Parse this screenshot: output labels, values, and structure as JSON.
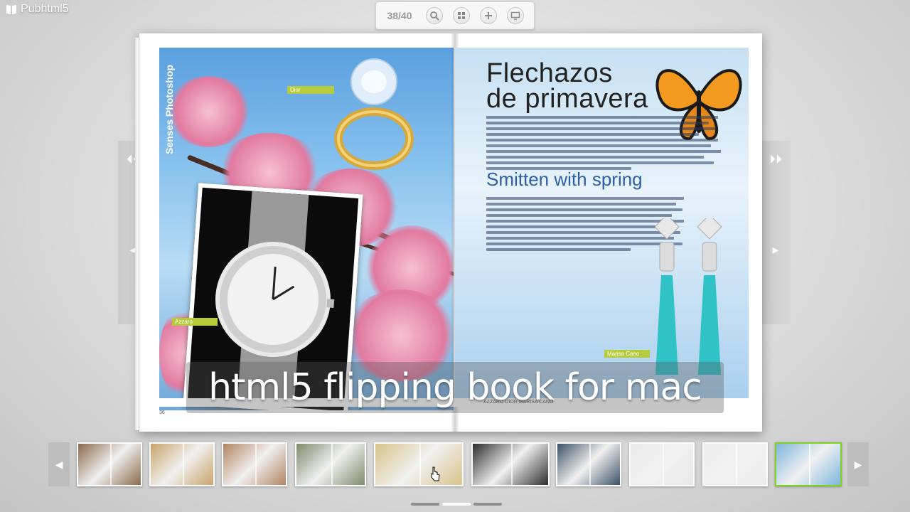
{
  "app": {
    "name": "Pubhtml5"
  },
  "toolbar": {
    "page_counter": "38/40",
    "buttons": [
      {
        "name": "search-icon",
        "label": "Search"
      },
      {
        "name": "grid-icon",
        "label": "Thumbnails"
      },
      {
        "name": "zoom-in-icon",
        "label": "Zoom in"
      },
      {
        "name": "fullscreen-icon",
        "label": "Fullscreen"
      }
    ]
  },
  "navigation": {
    "first_page_icon": "double-chevron-left-icon",
    "prev_page_icon": "chevron-left-icon",
    "last_page_icon": "double-chevron-right-icon",
    "next_page_icon": "chevron-right-icon"
  },
  "book": {
    "left_page": {
      "section_label": "Senses Photoshop",
      "tags": [
        "Dior",
        "Azzaro"
      ],
      "page_number": "36"
    },
    "right_page": {
      "title_line1": "Flechazos",
      "title_line2": "de primavera",
      "subtitle": "Smitten with spring",
      "tag": "Marisa Cano",
      "footer": "AZZARO  DIOR  MARISA CANO"
    }
  },
  "caption": "html5 flipping book for mac",
  "thumbnails": {
    "count": 10,
    "active_index": 9,
    "colors": [
      "#8a6a4a",
      "#c9a36a",
      "#b28460",
      "#7e8a6c",
      "#d9c38a",
      "#2c2c2c",
      "#3d5066",
      "#e9e9e9",
      "#ececec",
      "#7fb6de"
    ]
  },
  "pager": {
    "pages": 3,
    "active": 1
  },
  "colors": {
    "accent": "#7ed321",
    "tag": "#b7cc3a",
    "subtitle": "#2c5fa8"
  }
}
